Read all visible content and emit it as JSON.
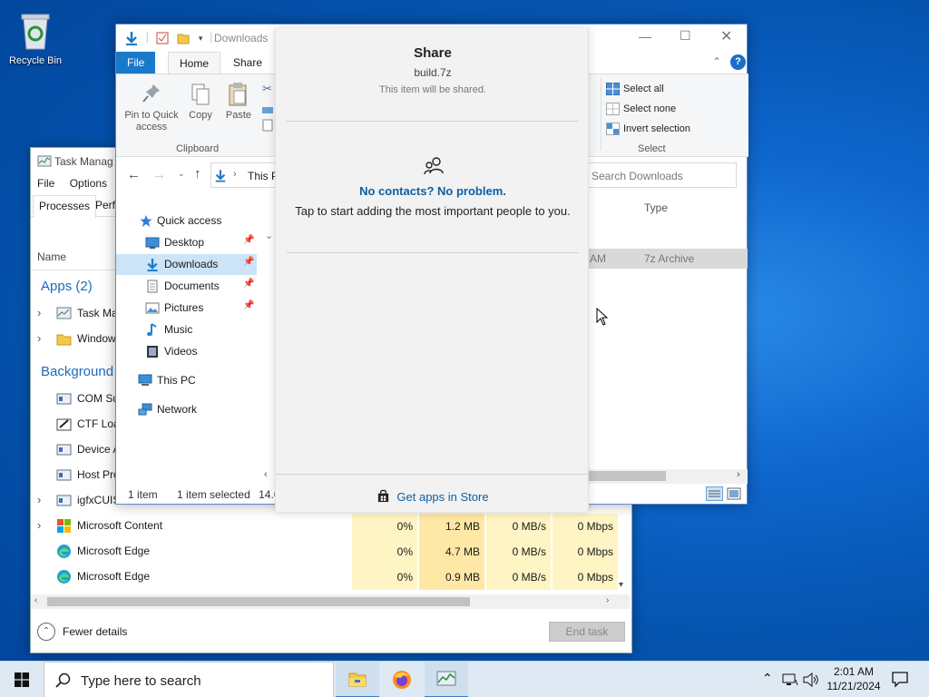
{
  "desktop": {
    "recycle_bin_label": "Recycle Bin"
  },
  "task_manager": {
    "title": "Task Manag",
    "menu": [
      "File",
      "Options"
    ],
    "tabs": [
      "Processes",
      "Perfo"
    ],
    "column_name": "Name",
    "apps_header": "Apps (2)",
    "background_header": "Background",
    "apps": [
      {
        "name": "Task Ma",
        "icon": "task-manager-icon"
      },
      {
        "name": "Window",
        "icon": "folder-icon"
      }
    ],
    "background": [
      {
        "name": "COM Su"
      },
      {
        "name": "CTF Loa"
      },
      {
        "name": "Device A"
      },
      {
        "name": "Host Pro"
      },
      {
        "name": "igfxCUIS"
      }
    ],
    "rows": [
      {
        "name": "Microsoft Content",
        "cpu": "0%",
        "memory": "1.2 MB",
        "disk": "0 MB/s",
        "network": "0 Mbps"
      },
      {
        "name": "Microsoft Edge",
        "cpu": "0%",
        "memory": "4.7 MB",
        "disk": "0 MB/s",
        "network": "0 Mbps"
      },
      {
        "name": "Microsoft Edge",
        "cpu": "0%",
        "memory": "0.9 MB",
        "disk": "0 MB/s",
        "network": "0 Mbps"
      }
    ],
    "fewer_details": "Fewer details",
    "end_task": "End task"
  },
  "explorer": {
    "title": "Downloads",
    "ribbon_tabs": {
      "file": "File",
      "home": "Home",
      "share": "Share"
    },
    "pin_label": "Pin to Quick access",
    "copy_label": "Copy",
    "paste_label": "Paste",
    "clipboard_group": "Clipboard",
    "select_all": "Select all",
    "select_none": "Select none",
    "invert_selection": "Invert selection",
    "select_group": "Select",
    "address": "This P",
    "search_placeholder": "Search Downloads",
    "column_type": "Type",
    "file_time": "AM",
    "file_type": "7z Archive",
    "nav": [
      {
        "label": "Quick access",
        "icon": "star-icon"
      },
      {
        "label": "Desktop",
        "icon": "desktop-icon",
        "pinned": true
      },
      {
        "label": "Downloads",
        "icon": "download-icon",
        "pinned": true
      },
      {
        "label": "Documents",
        "icon": "document-icon",
        "pinned": true
      },
      {
        "label": "Pictures",
        "icon": "pictures-icon",
        "pinned": true
      },
      {
        "label": "Music",
        "icon": "music-icon"
      },
      {
        "label": "Videos",
        "icon": "video-icon"
      },
      {
        "label": "This PC",
        "icon": "pc-icon"
      },
      {
        "label": "Network",
        "icon": "network-icon"
      }
    ],
    "status_items": "1 item",
    "status_selected": "1 item selected",
    "status_size": "14.6"
  },
  "share": {
    "title": "Share",
    "filename": "build.7z",
    "subtitle": "This item will be shared.",
    "no_contacts": "No contacts? No problem.",
    "tap_text": "Tap to start adding the most important people to you.",
    "store_link": "Get apps in Store"
  },
  "taskbar": {
    "search_placeholder": "Type here to search",
    "time": "2:01 AM",
    "date": "11/21/2024"
  },
  "colors": {
    "accent": "#1979ca",
    "link": "#0b5fa4",
    "selected_nav": "#cce4f7",
    "heat": "#fff4c4"
  }
}
